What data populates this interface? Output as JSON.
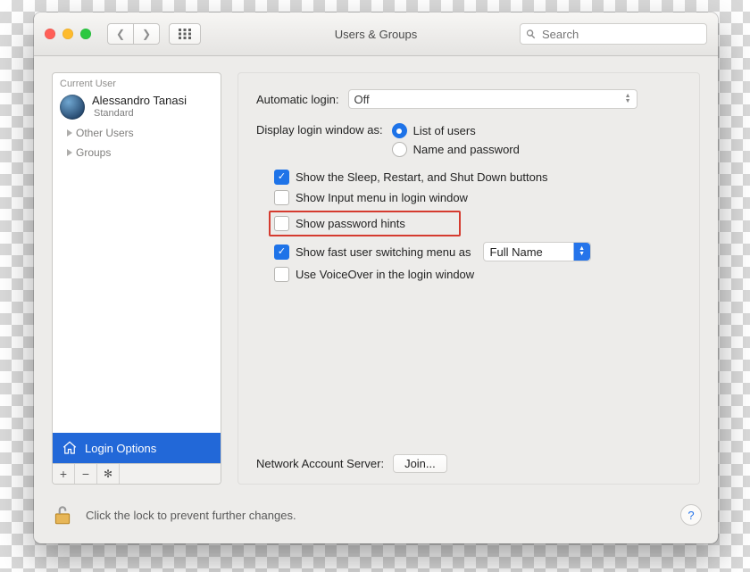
{
  "window": {
    "title": "Users & Groups",
    "search_placeholder": "Search"
  },
  "sidebar": {
    "header": "Current User",
    "current_user": {
      "full_name": "Alessandro Tanasi",
      "role": "Standard"
    },
    "groups_lbl": "Groups",
    "others_lbl": "Other Users",
    "login_options": "Login Options"
  },
  "settings": {
    "auto_login_lbl": "Automatic login:",
    "auto_login_val": "Off",
    "display_as_lbl": "Display login window as:",
    "radio_list": "List of users",
    "radio_namepw": "Name and password",
    "opt_sleep": "Show the Sleep, Restart, and Shut Down buttons",
    "opt_input": "Show Input menu in login window",
    "opt_pwhints": "Show password hints",
    "opt_fastsw": "Show fast user switching menu as",
    "fastsw_val": "Full Name",
    "opt_vo": "Use VoiceOver in the login window",
    "net_lbl": "Network Account Server:",
    "join_btn": "Join..."
  },
  "footer": {
    "lock_msg": "Click the lock to prevent further changes.",
    "help": "?"
  }
}
